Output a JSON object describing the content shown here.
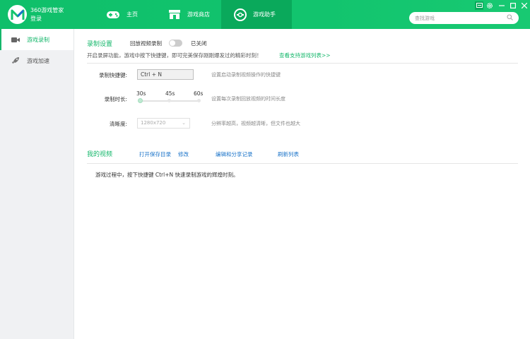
{
  "app": {
    "name": "360游戏管家",
    "login": "登录"
  },
  "nav": {
    "home": "主页",
    "store": "游戏商店",
    "assistant": "游戏助手"
  },
  "search": {
    "placeholder": "查找游戏"
  },
  "sidebar": {
    "items": [
      {
        "label": "游戏录制",
        "icon": "video-camera-icon",
        "active": true
      },
      {
        "label": "游戏加速",
        "icon": "rocket-icon",
        "active": false
      }
    ]
  },
  "record_settings": {
    "title": "录制设置",
    "replay_label": "回放视频录制",
    "replay_state": "已关闭",
    "replay_enabled": false,
    "description": "开启录屏功能，游戏中按下快捷键，即可完美保存刚刚爆发过的精彩时刻！",
    "supported_link": "查看支持游戏列表>>",
    "hotkey_label": "录制快捷键:",
    "hotkey_value": "Ctrl + N",
    "hotkey_hint": "设置启动录制视频操作的快捷键",
    "duration_label": "录制时长:",
    "duration_ticks": [
      "30s",
      "45s",
      "60s"
    ],
    "duration_selected": "30s",
    "duration_hint": "设置每次录制回放视频的时间长度",
    "resolution_label": "清晰度:",
    "resolution_value": "1280x720",
    "resolution_hint": "分辨率越高，视频越清晰，但文件也越大"
  },
  "my_videos": {
    "title": "我的视频",
    "links": {
      "open_folder": "打开保存目录",
      "modify": "修改",
      "edit_share": "编辑和分享记录",
      "refresh": "刷新列表"
    },
    "empty_message": "游戏过程中，按下快捷键 Ctrl+N 快速录制游戏的辉煌时刻。"
  },
  "colors": {
    "brand_green": "#12c46e",
    "active_nav": "#0aa95b",
    "link_blue": "#1a73c9"
  }
}
